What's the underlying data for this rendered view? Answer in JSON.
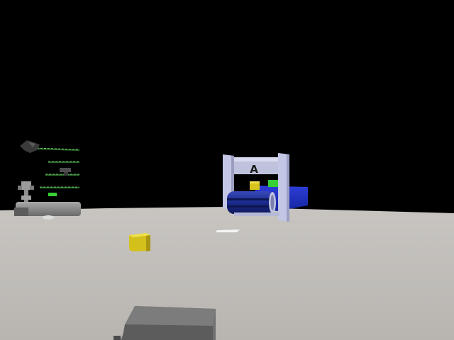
{
  "scene": {
    "station_sign": "A",
    "colors": {
      "sky": "#000000",
      "floor": "#bdbab6",
      "floor_far": "#c6c3bf",
      "station_frame": "#c3c6e4",
      "conveyor": "#1c2c9a",
      "cube": "#e3cf1e",
      "marker": "#3ed43e",
      "robot_body": "#8c8c8c",
      "crate": "#6f6f6f"
    }
  }
}
